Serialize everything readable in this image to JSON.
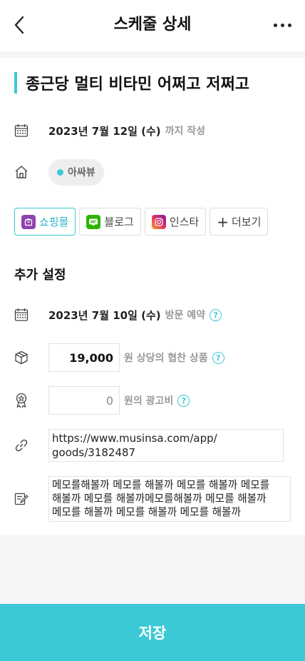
{
  "header": {
    "title": "스케줄 상세"
  },
  "schedule": {
    "title": "종근당 멀티 비타민 어쩌고 저쩌고",
    "deadline_date": "2023년 7월 12일 (수)",
    "deadline_suffix": "까지 작성",
    "tag": "아싸뷰"
  },
  "channels": [
    {
      "label": "쇼핑몰",
      "icon": "shop-icon",
      "color": "#8e44ad"
    },
    {
      "label": "블로그",
      "icon": "blog-icon",
      "color": "#2db400"
    },
    {
      "label": "인스타",
      "icon": "instagram-icon",
      "color": "#e1306c"
    },
    {
      "label": "더보기",
      "icon": "plus-icon"
    }
  ],
  "extra": {
    "section_title": "추가 설정",
    "visit_date": "2023년 7월 10일 (수)",
    "visit_suffix": "방문 예약",
    "sponsorship_value": "19,000",
    "sponsorship_suffix": "원 상당의 협찬 상품",
    "ad_fee_value": "0",
    "ad_fee_suffix": "원의 광고비",
    "url_line1": "https://www.musinsa.com/app/",
    "url_line2": "goods/3182487",
    "memo_line1": "메모를해볼까 메모를 해볼까 메모를 해볼까 메모를",
    "memo_line2": "해볼까 메모를 해볼까메모를해볼까 메모를 해볼까",
    "memo_line3": "메모를 해볼까 메모를 해볼까 메모를 해볼까",
    "help_symbol": "?"
  },
  "save_label": "저장",
  "colors": {
    "accent": "#3bc9d6",
    "muted": "#999999"
  }
}
